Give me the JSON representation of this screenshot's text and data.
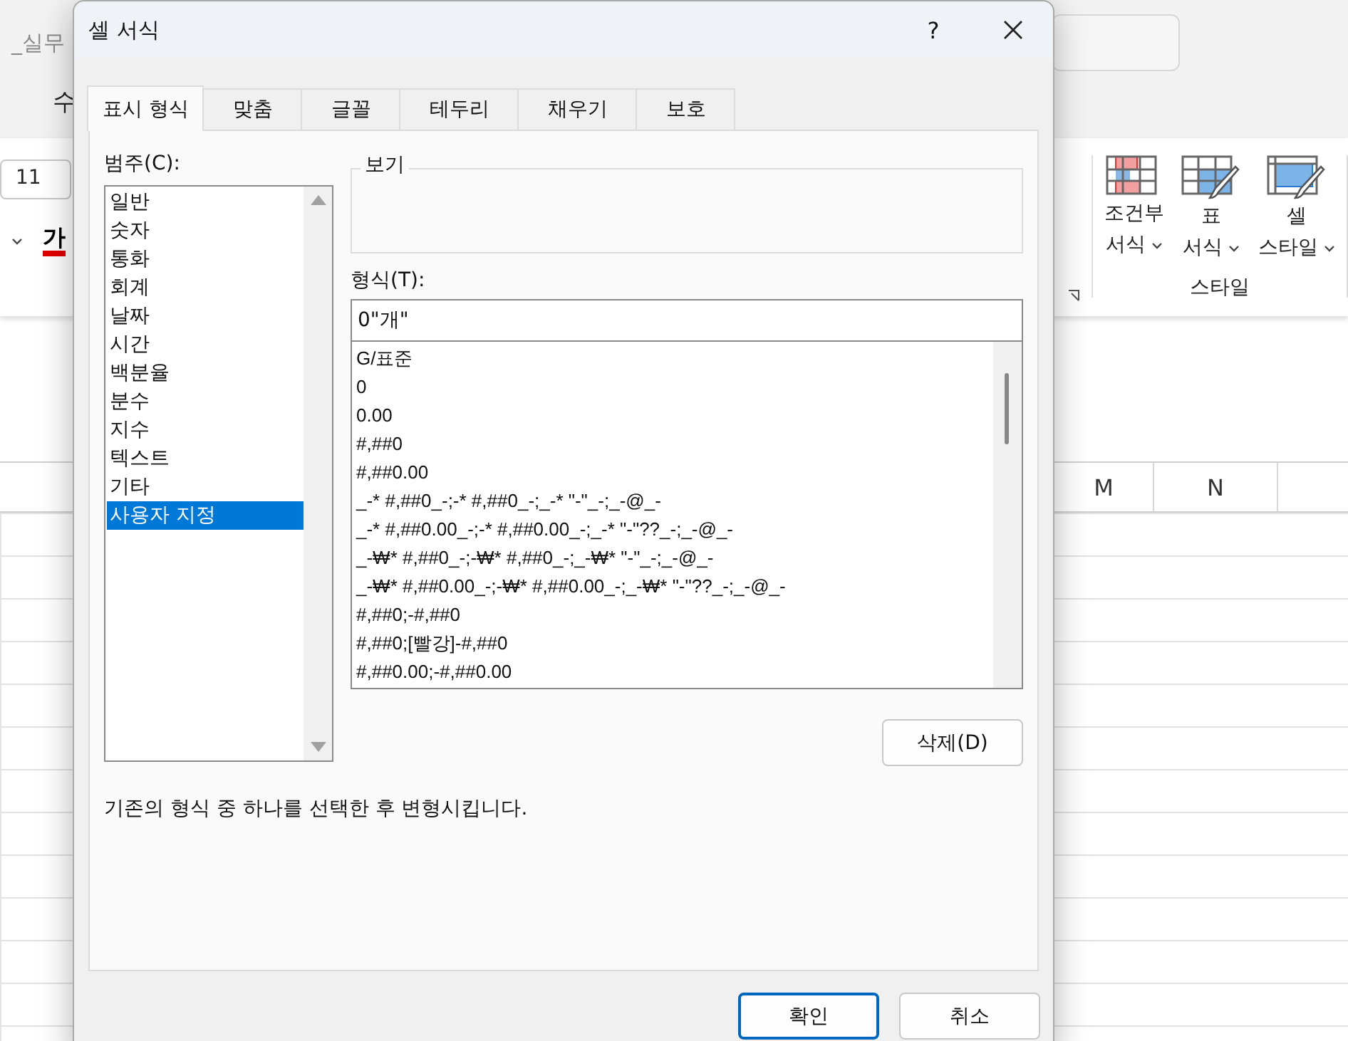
{
  "excel": {
    "title_fragment": "_실무",
    "menu": [
      "수"
    ],
    "font_size": "11",
    "font_color_glyph": "가",
    "styles_group": {
      "label": "스타일",
      "buttons": [
        {
          "kind": "conditional",
          "lines": [
            "조건부",
            "서식"
          ]
        },
        {
          "kind": "table",
          "lines": [
            "표",
            "서식"
          ]
        },
        {
          "kind": "cell",
          "lines": [
            "셀",
            "스타일"
          ]
        }
      ]
    },
    "columns": [
      "M",
      "N"
    ]
  },
  "dialog": {
    "title": "셀 서식",
    "help": "?",
    "tabs": [
      {
        "label": "표시 형식",
        "selected": true
      },
      {
        "label": "맞춤",
        "selected": false
      },
      {
        "label": "글꼴",
        "selected": false
      },
      {
        "label": "테두리",
        "selected": false
      },
      {
        "label": "채우기",
        "selected": false
      },
      {
        "label": "보호",
        "selected": false
      }
    ],
    "category_label": "범주(C):",
    "categories": [
      {
        "label": "일반",
        "selected": false
      },
      {
        "label": "숫자",
        "selected": false
      },
      {
        "label": "통화",
        "selected": false
      },
      {
        "label": "회계",
        "selected": false
      },
      {
        "label": "날짜",
        "selected": false
      },
      {
        "label": "시간",
        "selected": false
      },
      {
        "label": "백분율",
        "selected": false
      },
      {
        "label": "분수",
        "selected": false
      },
      {
        "label": "지수",
        "selected": false
      },
      {
        "label": "텍스트",
        "selected": false
      },
      {
        "label": "기타",
        "selected": false
      },
      {
        "label": "사용자 지정",
        "selected": true
      }
    ],
    "preview_label": "보기",
    "format_label": "형식(T):",
    "format_value": "0\"개\"",
    "formats": [
      "G/표준",
      "0",
      "0.00",
      "#,##0",
      "#,##0.00",
      "_-* #,##0_-;-* #,##0_-;_-* \"-\"_-;_-@_-",
      "_-* #,##0.00_-;-* #,##0.00_-;_-* \"-\"??_-;_-@_-",
      "_-₩* #,##0_-;-₩* #,##0_-;_-₩* \"-\"_-;_-@_-",
      "_-₩* #,##0.00_-;-₩* #,##0.00_-;_-₩* \"-\"??_-;_-@_-",
      "#,##0;-#,##0",
      "#,##0;[빨강]-#,##0",
      "#,##0.00;-#,##0.00"
    ],
    "delete_button": "삭제(D)",
    "description": "기존의 형식 중 하나를 선택한 후 변형시킵니다.",
    "ok": "확인",
    "cancel": "취소"
  }
}
